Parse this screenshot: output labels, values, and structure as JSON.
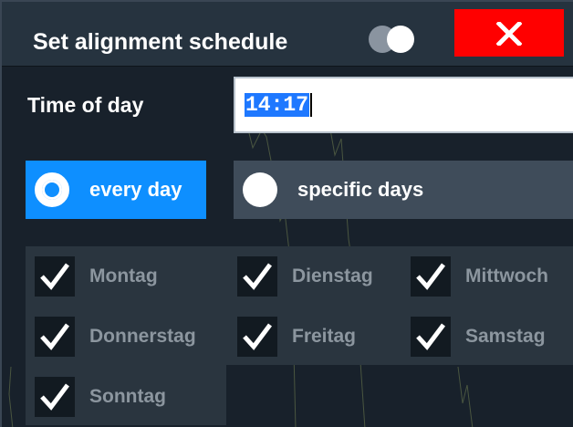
{
  "dialog": {
    "title": "Set alignment schedule",
    "close_icon": "close-icon",
    "toggle_icon": "toggle-icon"
  },
  "time_of_day": {
    "label": "Time of day",
    "value": "14:17"
  },
  "recurrence": {
    "options": [
      {
        "label": "every day",
        "selected": true
      },
      {
        "label": "specific days",
        "selected": false
      }
    ]
  },
  "days": [
    {
      "label": "Montag",
      "checked": true
    },
    {
      "label": "Dienstag",
      "checked": true
    },
    {
      "label": "Mittwoch",
      "checked": true
    },
    {
      "label": "Donnerstag",
      "checked": true
    },
    {
      "label": "Freitag",
      "checked": true
    },
    {
      "label": "Samstag",
      "checked": true
    },
    {
      "label": "Sonntag",
      "checked": true
    }
  ],
  "colors": {
    "accent": "#0e8fff",
    "close": "#ff0000"
  }
}
